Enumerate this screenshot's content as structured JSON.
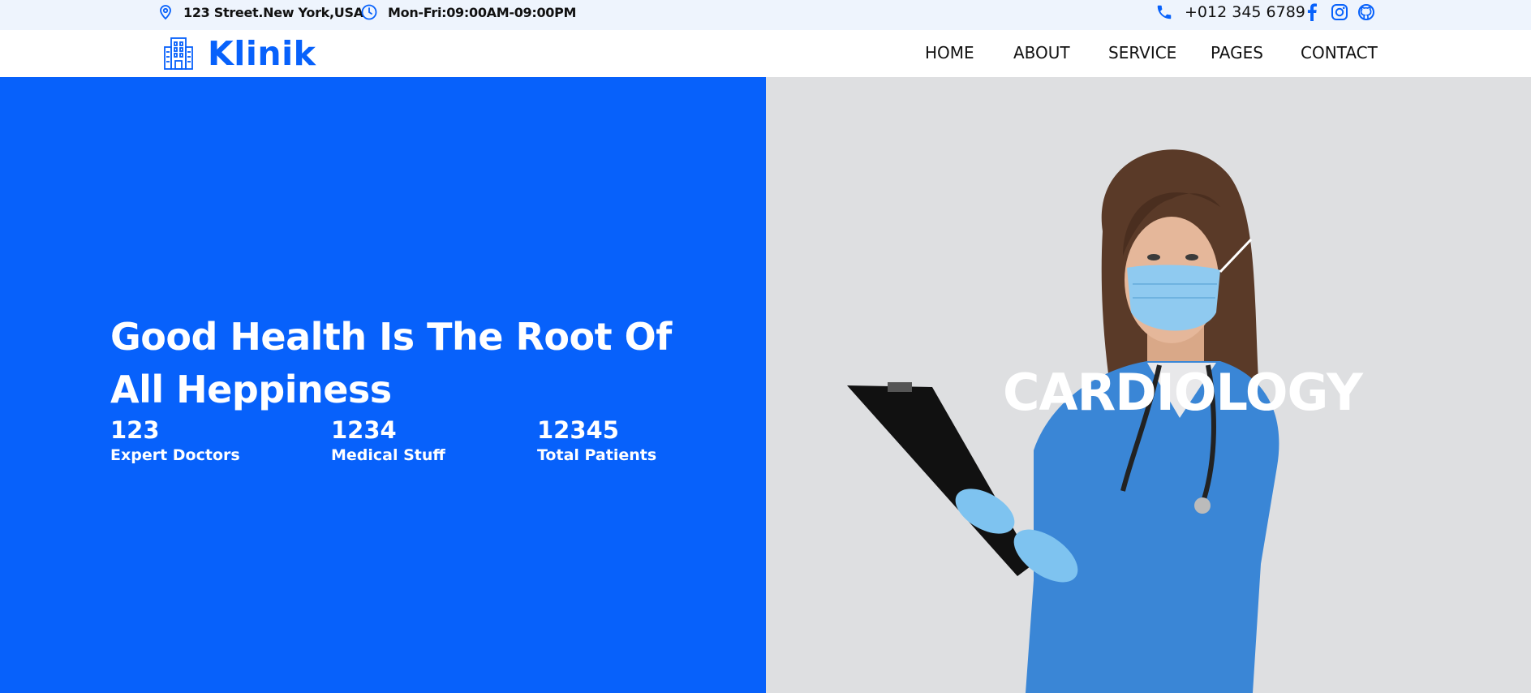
{
  "topbar": {
    "address": "123 Street.New York,USA",
    "hours": "Mon-Fri:09:00AM-09:00PM",
    "phone": "+012 345 6789",
    "icons": [
      "map-pin-icon",
      "clock-icon",
      "phone-icon",
      "facebook-icon",
      "instagram-icon",
      "github-icon"
    ]
  },
  "brand": {
    "name": "Klinik",
    "icon": "hospital-building-icon"
  },
  "nav": {
    "items": [
      {
        "label": "HOME"
      },
      {
        "label": "ABOUT"
      },
      {
        "label": "SERVICE"
      },
      {
        "label": "PAGES"
      },
      {
        "label": "CONTACT"
      }
    ]
  },
  "hero": {
    "headline_line1": "Good Health Is The Root Of",
    "headline_line2": "All Heppiness",
    "stats": [
      {
        "value": "123",
        "label": "Expert Doctors"
      },
      {
        "value": "1234",
        "label": "Medical Stuff"
      },
      {
        "value": "12345",
        "label": "Total Patients"
      }
    ],
    "slide_title": "CARDIOLOGY"
  },
  "colors": {
    "primary": "#0761fb",
    "topbar_bg": "#eef4fd",
    "photo_bg": "#dedfe1",
    "scrubs": "#3a86d6",
    "mask": "#8fcaf0"
  }
}
